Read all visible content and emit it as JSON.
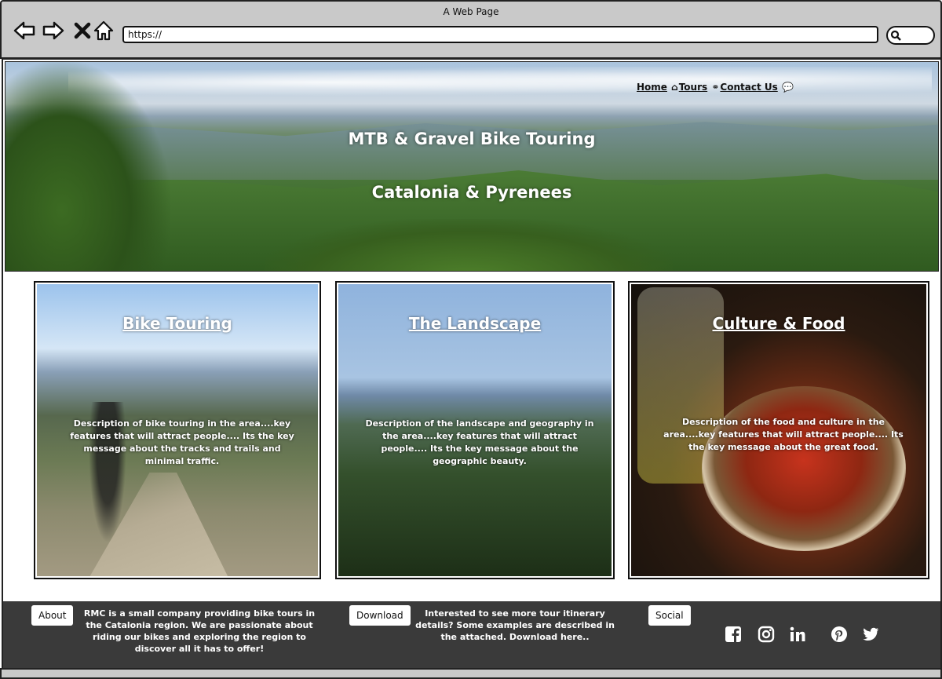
{
  "window": {
    "title": "A Web Page"
  },
  "browser": {
    "url": "https://",
    "back_icon": "back-arrow-icon",
    "forward_icon": "forward-arrow-icon",
    "close_icon": "x-icon",
    "home_icon": "home-icon",
    "search_icon": "search-icon"
  },
  "hero": {
    "title": "MTB & Gravel Bike Touring",
    "subtitle": "Catalonia & Pyrenees",
    "nav": [
      {
        "label": "Home",
        "icon": "home-icon"
      },
      {
        "label": "Tours",
        "icon": "bike-icon"
      },
      {
        "label": "Contact Us",
        "icon": "speech-bubble-icon"
      }
    ]
  },
  "cards": [
    {
      "title": "Bike Touring",
      "description": "Description of bike touring in the area....key features that will attract people.... Its the key message about the tracks and trails and minimal traffic."
    },
    {
      "title": "The Landscape",
      "description": "Description of the landscape and geography in the area....key features that will attract people.... Its the key message about the geographic beauty."
    },
    {
      "title": "Culture & Food",
      "description": "Description of the food and culture in the area....key features that will attract people.... Its the key message about the great food."
    }
  ],
  "footer": {
    "about_label": "About",
    "about_text": "RMC is a small company providing bike tours in the Catalonia region. We are passionate about riding our bikes and exploring the region to discover all it has to offer!",
    "download_label": "Download",
    "download_text": "Interested to see more tour itinerary details? Some examples are described in the attached. Download here..",
    "social_label": "Social",
    "social_icons": [
      "facebook-icon",
      "instagram-icon",
      "linkedin-icon",
      "pinterest-icon",
      "twitter-icon"
    ]
  }
}
